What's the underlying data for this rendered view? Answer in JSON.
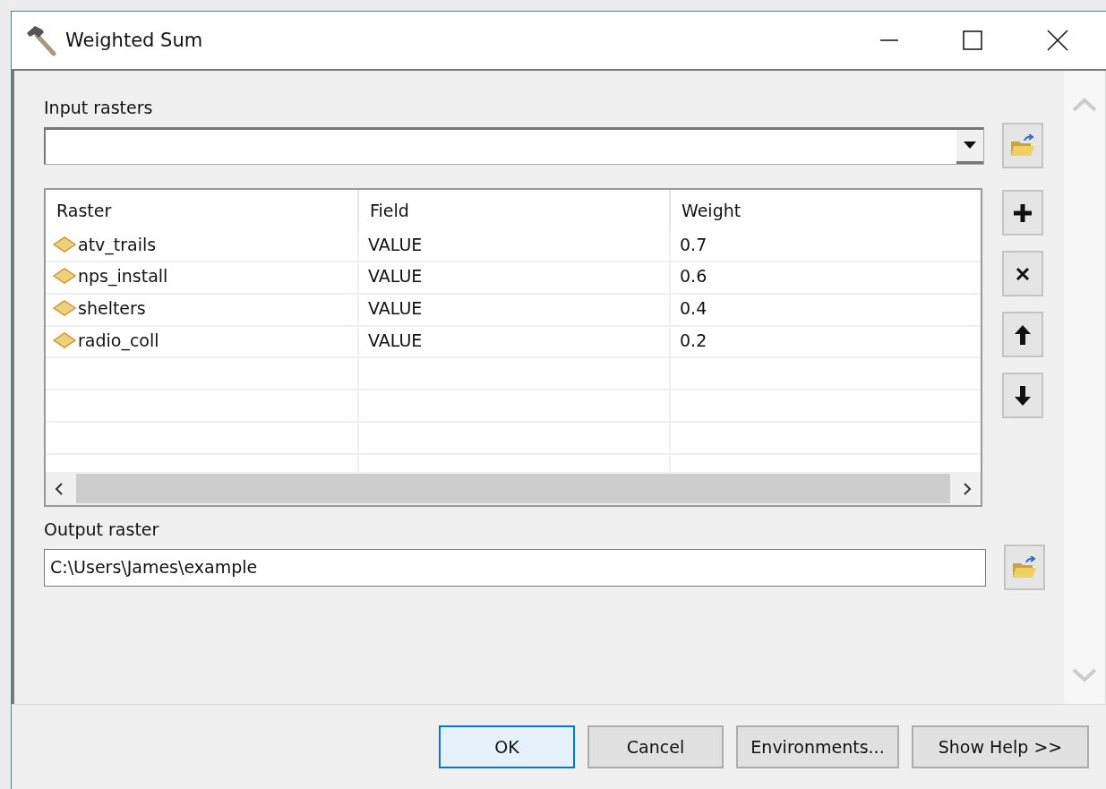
{
  "window": {
    "title": "Weighted Sum"
  },
  "input_rasters": {
    "label": "Input rasters"
  },
  "table": {
    "columns": [
      "Raster",
      "Field",
      "Weight"
    ],
    "rows": [
      {
        "raster": "atv_trails",
        "field": "VALUE",
        "weight": "0.7"
      },
      {
        "raster": "nps_install",
        "field": "VALUE",
        "weight": "0.6"
      },
      {
        "raster": "shelters",
        "field": "VALUE",
        "weight": "0.4"
      },
      {
        "raster": "radio_coll",
        "field": "VALUE",
        "weight": "0.2"
      }
    ]
  },
  "output_raster": {
    "label": "Output raster",
    "value": "C:\\Users\\James\\example"
  },
  "buttons": [
    {
      "label": "OK",
      "focused": true
    },
    {
      "label": "Cancel",
      "focused": false
    },
    {
      "label": "Environments...",
      "focused": false
    },
    {
      "label": "Show Help >>",
      "focused": false
    }
  ]
}
